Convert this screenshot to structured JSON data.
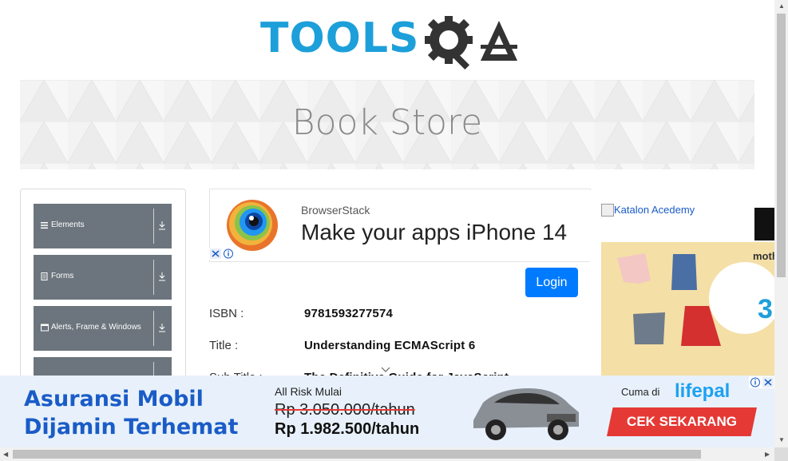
{
  "logo": {
    "text_left": "TOOLS",
    "text_right": "QA"
  },
  "banner": {
    "title": "Book Store"
  },
  "sidebar": {
    "items": [
      {
        "label": "Elements",
        "icon": "hamburger-icon"
      },
      {
        "label": "Forms",
        "icon": "document-icon"
      },
      {
        "label": "Alerts, Frame & Windows",
        "icon": "window-icon"
      },
      {
        "label": "",
        "icon": ""
      }
    ]
  },
  "ad_top": {
    "brand": "BrowserStack",
    "headline": "Make your apps iPhone 14"
  },
  "login": {
    "label": "Login"
  },
  "book": {
    "isbn_label": "ISBN :",
    "isbn": "9781593277574",
    "title_label": "Title :",
    "title": "Understanding ECMAScript 6",
    "subtitle_label": "Sub Title :",
    "subtitle": "The Definitive Guide for JavaScript"
  },
  "right_ad": {
    "katalon_alt": "Katalon Acedemy",
    "mothercare": "moth"
  },
  "bottom_ad": {
    "headline_line1": "Asuransi Mobil",
    "headline_line2": "Dijamin Terhemat",
    "all_risk": "All Risk Mulai",
    "old_price": "Rp 3.050.000/tahun",
    "new_price": "Rp 1.982.500/tahun",
    "cuma_di": "Cuma di",
    "brand": "lifepal",
    "cta": "CEK SEKARANG"
  },
  "colors": {
    "accent_blue": "#007bff",
    "sidebar_grey": "#6c757d",
    "logo_blue": "#1d9fd9",
    "cta_red": "#e53935"
  }
}
